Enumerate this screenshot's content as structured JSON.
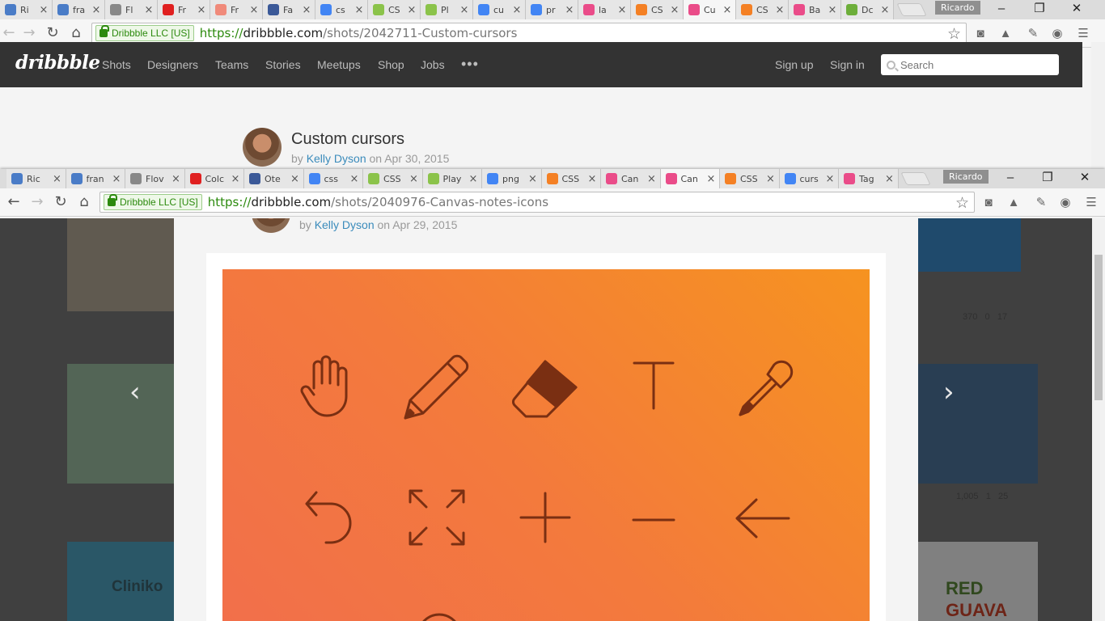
{
  "win1": {
    "tabs": [
      {
        "label": "Ri",
        "color": "#4a7cc7"
      },
      {
        "label": "fra",
        "color": "#4a7cc7"
      },
      {
        "label": "Fl",
        "color": "#888888"
      },
      {
        "label": "Fr",
        "color": "#e02020"
      },
      {
        "label": "Fr",
        "color": "#f08a7a"
      },
      {
        "label": "Fa",
        "color": "#3b5998"
      },
      {
        "label": "cs",
        "color": "#4285f4"
      },
      {
        "label": "CS",
        "color": "#8bc34a"
      },
      {
        "label": "Pl",
        "color": "#8bc34a"
      },
      {
        "label": "cu",
        "color": "#4285f4"
      },
      {
        "label": "pr",
        "color": "#4285f4"
      },
      {
        "label": "la",
        "color": "#ea4c89"
      },
      {
        "label": "CS",
        "color": "#f48024"
      },
      {
        "label": "Cu",
        "color": "#ea4c89"
      },
      {
        "label": "CS",
        "color": "#f48024"
      },
      {
        "label": "Ba",
        "color": "#ea4c89"
      },
      {
        "label": "Dc",
        "color": "#6dae3a"
      }
    ],
    "profile": "Ricardo",
    "secure_label": "Dribbble LLC [US]",
    "url": {
      "scheme": "https://",
      "host": "dribbble.com",
      "path": "/shots/2042711-Custom-cursors"
    },
    "nav": [
      "Shots",
      "Designers",
      "Teams",
      "Stories",
      "Meetups",
      "Shop",
      "Jobs"
    ],
    "more": "•••",
    "signup": "Sign up",
    "signin": "Sign in",
    "search_placeholder": "Search",
    "logo": "dribbble",
    "shot": {
      "title": "Custom cursors",
      "by": "by",
      "author": "Kelly Dyson",
      "on": "on",
      "date": "Apr 30, 2015"
    }
  },
  "win2": {
    "tabs": [
      {
        "label": "Ric",
        "color": "#4a7cc7"
      },
      {
        "label": "fran",
        "color": "#4a7cc7"
      },
      {
        "label": "Flov",
        "color": "#888888"
      },
      {
        "label": "Colc",
        "color": "#e02020"
      },
      {
        "label": "Ote",
        "color": "#3b5998"
      },
      {
        "label": "css",
        "color": "#4285f4"
      },
      {
        "label": "CSS",
        "color": "#8bc34a"
      },
      {
        "label": "Play",
        "color": "#8bc34a"
      },
      {
        "label": "png",
        "color": "#4285f4"
      },
      {
        "label": "CSS",
        "color": "#f48024"
      },
      {
        "label": "Can",
        "color": "#ea4c89"
      },
      {
        "label": "Can",
        "color": "#ea4c89"
      },
      {
        "label": "CSS",
        "color": "#f48024"
      },
      {
        "label": "curs",
        "color": "#4285f4"
      },
      {
        "label": "Tag",
        "color": "#ea4c89"
      }
    ],
    "profile": "Ricardo",
    "secure_label": "Dribbble LLC [US]",
    "url": {
      "scheme": "https://",
      "host": "dribbble.com",
      "path": "/shots/2040976-Canvas-notes-icons"
    },
    "shot": {
      "by": "by",
      "author": "Kelly Dyson",
      "on": "on",
      "date": "Apr 29, 2015"
    },
    "background": {
      "stats_right_1": [
        "370",
        "0",
        "17"
      ],
      "stats_right_2": [
        "1,005",
        "1",
        "25"
      ],
      "card_text_left": "Cliniko",
      "card_text_right_1": "RED",
      "card_text_right_2": "GUAVA"
    }
  },
  "icons": [
    "hand-icon",
    "pencil-icon",
    "eraser-icon",
    "text-icon",
    "eyedropper-icon",
    "undo-icon",
    "expand-icon",
    "plus-icon",
    "minus-icon",
    "arrow-left-icon"
  ],
  "colors": {
    "header": "#333333",
    "accent": "#ea4c89",
    "link": "#3a8bbb",
    "gradient_start": "#f26f4b",
    "gradient_end": "#f69320",
    "icon_stroke": "#7a2f12"
  }
}
